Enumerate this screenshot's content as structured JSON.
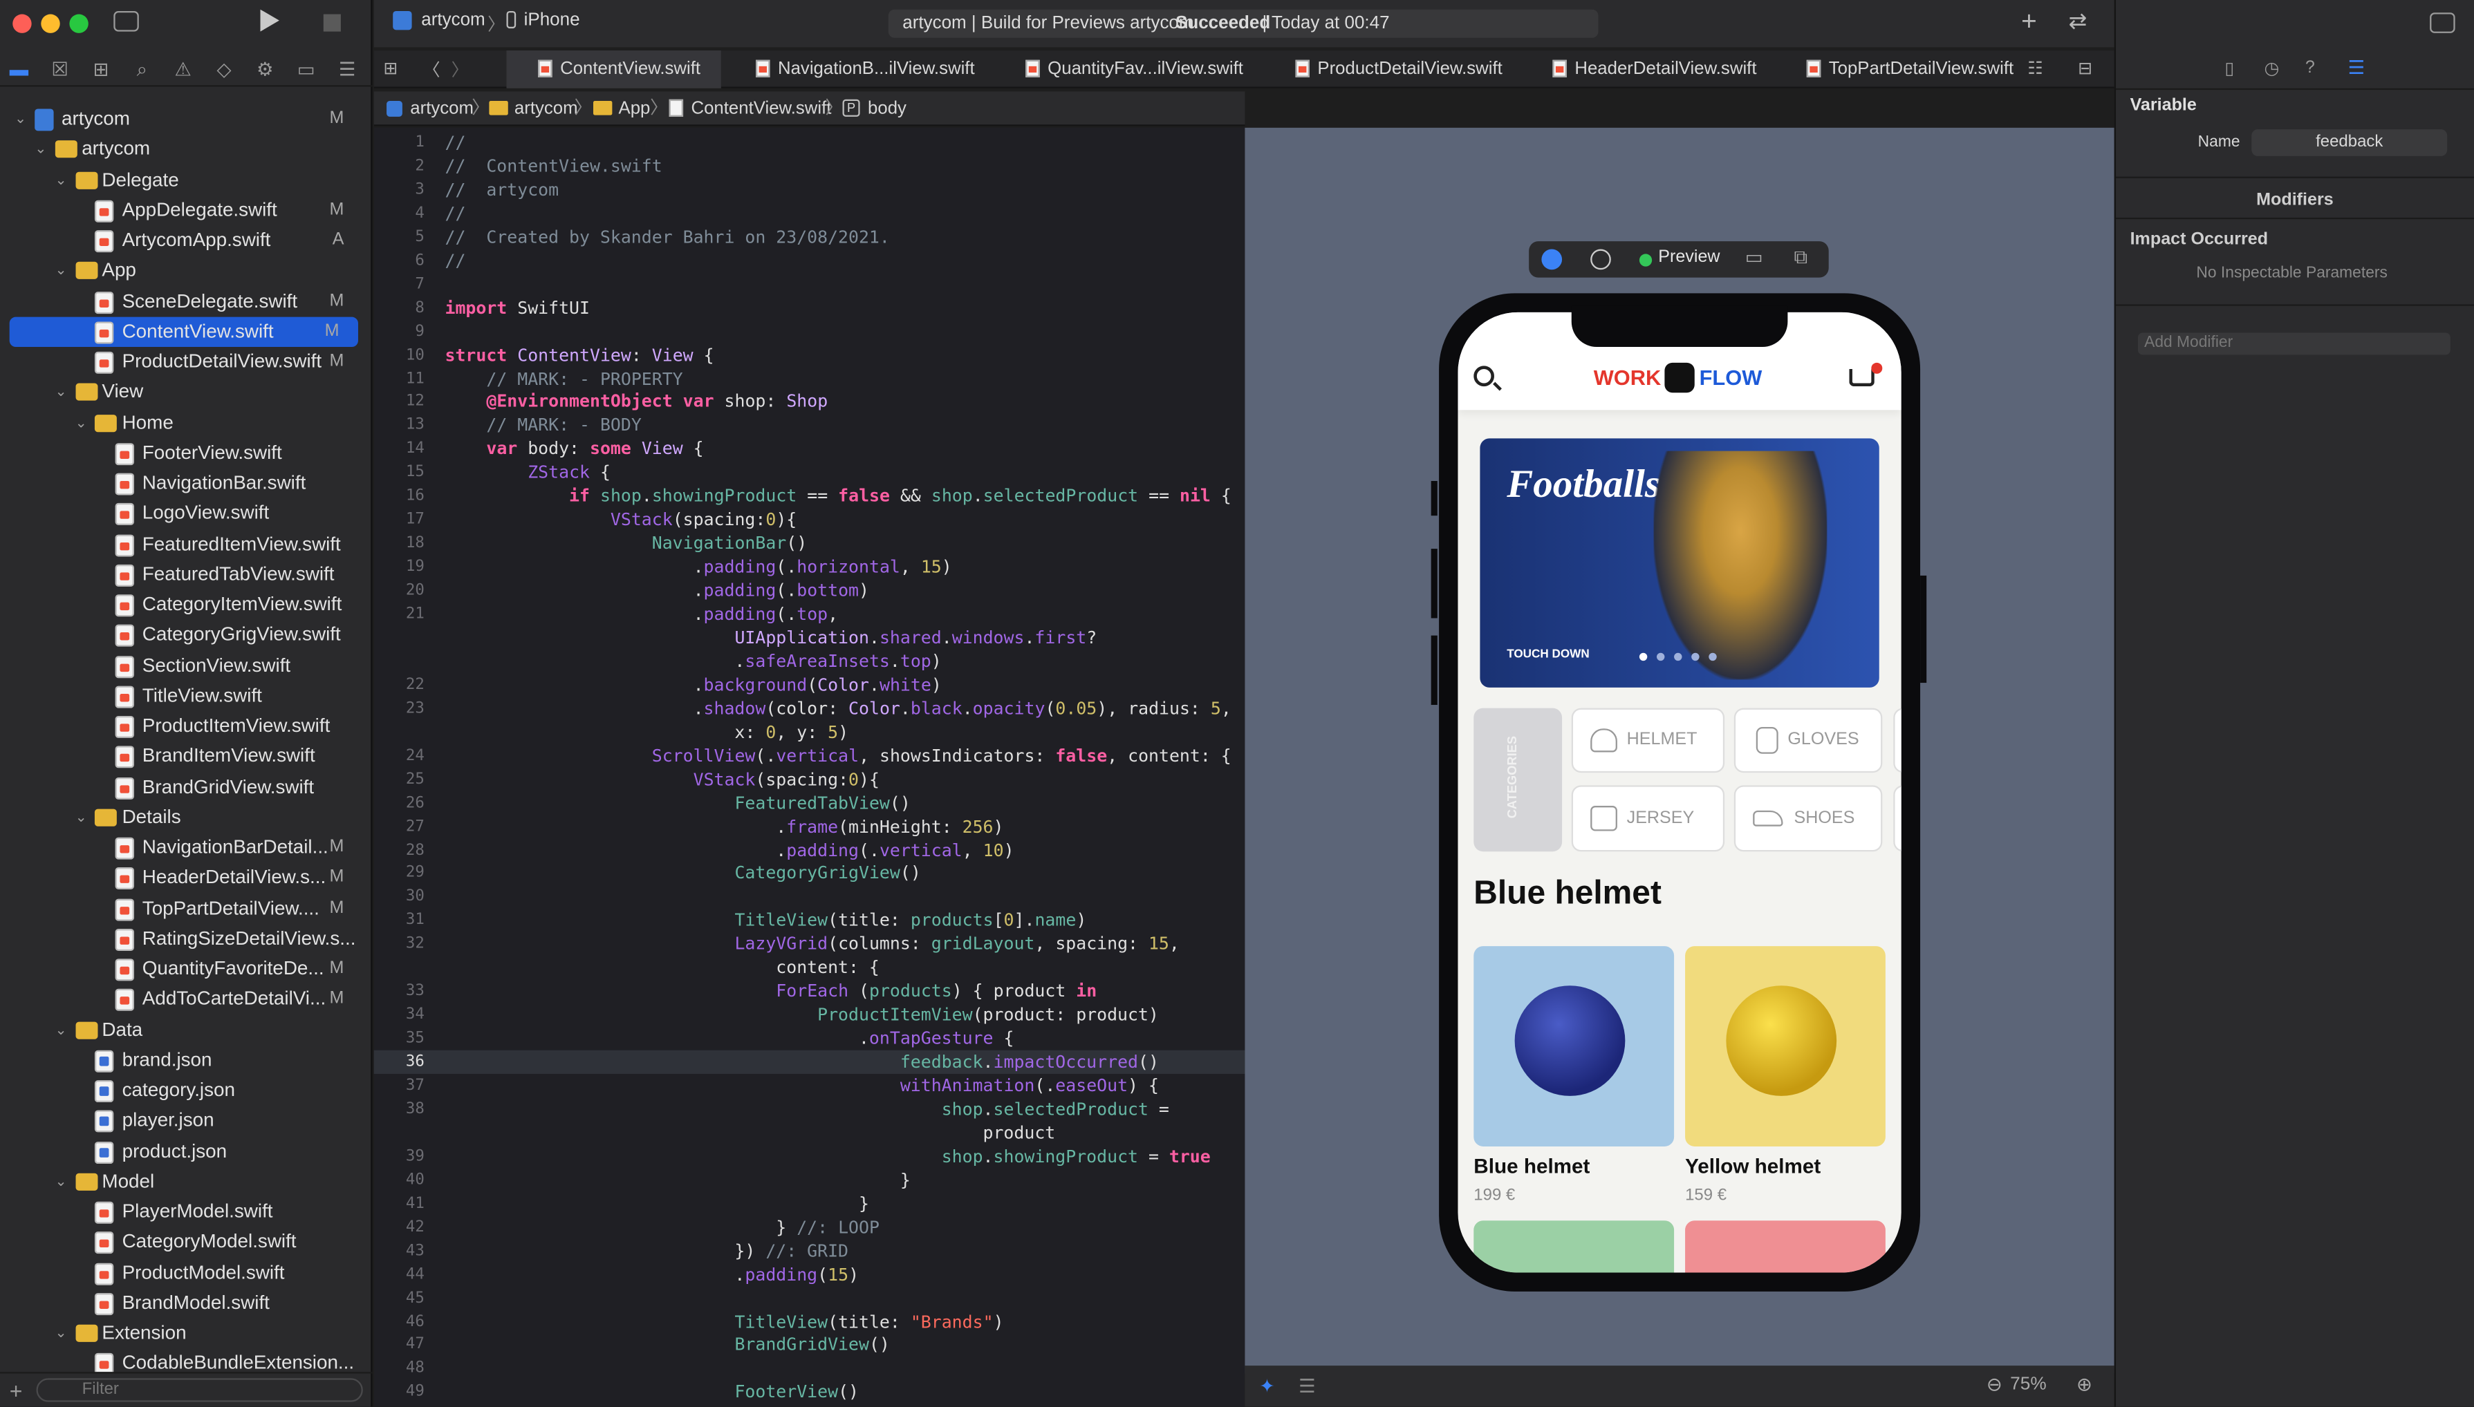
{
  "window": {
    "project": "artycom",
    "device": "iPhone",
    "activity_prefix": "artycom | Build for Previews artycom: ",
    "activity_status": "Succeeded",
    "activity_suffix": " | Today at 00:47"
  },
  "tabs": [
    "ContentView.swift",
    "NavigationB...ilView.swift",
    "QuantityFav...ilView.swift",
    "ProductDetailView.swift",
    "HeaderDetailView.swift",
    "TopPartDetailView.swift"
  ],
  "jumpbar": [
    "artycom",
    "artycom",
    "App",
    "ContentView.swift",
    "body"
  ],
  "navigator": {
    "filter_placeholder": "Filter",
    "items": [
      {
        "label": "artycom",
        "status": "M"
      },
      {
        "label": "artycom",
        "status": ""
      },
      {
        "label": "Delegate",
        "status": ""
      },
      {
        "label": "AppDelegate.swift",
        "status": "M"
      },
      {
        "label": "ArtycomApp.swift",
        "status": "A"
      },
      {
        "label": "App",
        "status": ""
      },
      {
        "label": "SceneDelegate.swift",
        "status": "M"
      },
      {
        "label": "ContentView.swift",
        "status": "M"
      },
      {
        "label": "ProductDetailView.swift",
        "status": "M"
      },
      {
        "label": "View",
        "status": ""
      },
      {
        "label": "Home",
        "status": ""
      },
      {
        "label": "FooterView.swift",
        "status": ""
      },
      {
        "label": "NavigationBar.swift",
        "status": ""
      },
      {
        "label": "LogoView.swift",
        "status": ""
      },
      {
        "label": "FeaturedItemView.swift",
        "status": ""
      },
      {
        "label": "FeaturedTabView.swift",
        "status": ""
      },
      {
        "label": "CategoryItemView.swift",
        "status": ""
      },
      {
        "label": "CategoryGrigView.swift",
        "status": ""
      },
      {
        "label": "SectionView.swift",
        "status": ""
      },
      {
        "label": "TitleView.swift",
        "status": ""
      },
      {
        "label": "ProductItemView.swift",
        "status": ""
      },
      {
        "label": "BrandItemView.swift",
        "status": ""
      },
      {
        "label": "BrandGridView.swift",
        "status": ""
      },
      {
        "label": "Details",
        "status": ""
      },
      {
        "label": "NavigationBarDetail...",
        "status": "M"
      },
      {
        "label": "HeaderDetailView.s...",
        "status": "M"
      },
      {
        "label": "TopPartDetailView....",
        "status": "M"
      },
      {
        "label": "RatingSizeDetailView.s...",
        "status": ""
      },
      {
        "label": "QuantityFavoriteDe...",
        "status": "M"
      },
      {
        "label": "AddToCarteDetailVi...",
        "status": "M"
      },
      {
        "label": "Data",
        "status": ""
      },
      {
        "label": "brand.json",
        "status": ""
      },
      {
        "label": "category.json",
        "status": ""
      },
      {
        "label": "player.json",
        "status": ""
      },
      {
        "label": "product.json",
        "status": ""
      },
      {
        "label": "Model",
        "status": ""
      },
      {
        "label": "PlayerModel.swift",
        "status": ""
      },
      {
        "label": "CategoryModel.swift",
        "status": ""
      },
      {
        "label": "ProductModel.swift",
        "status": ""
      },
      {
        "label": "BrandModel.swift",
        "status": ""
      },
      {
        "label": "Extension",
        "status": ""
      },
      {
        "label": "CodableBundleExtension...",
        "status": ""
      }
    ]
  },
  "code_line_numbers": [
    "1",
    "2",
    "3",
    "4",
    "5",
    "6",
    "7",
    "8",
    "9",
    "10",
    "11",
    "12",
    "13",
    "14",
    "15",
    "16",
    "17",
    "18",
    "19",
    "20",
    "21",
    "",
    "",
    "22",
    "23",
    "",
    "24",
    "25",
    "26",
    "27",
    "28",
    "29",
    "30",
    "31",
    "32",
    "",
    "33",
    "34",
    "35",
    "36",
    "37",
    "38",
    "",
    "39",
    "40",
    "41",
    "42",
    "43",
    "44",
    "45",
    "46",
    "47",
    "48",
    "49"
  ],
  "preview": {
    "label": "Preview",
    "logo_left": "WORK",
    "logo_right": "FLOW",
    "hero_title": "Footballs",
    "hero_brand": "TOUCH DOWN",
    "categories_label": "CATEGORIES",
    "categories": [
      "HELMET",
      "GLOVES",
      "JERSEY",
      "SHOES"
    ],
    "section_title": "Blue helmet",
    "products": [
      {
        "name": "Blue helmet",
        "price": "199 €"
      },
      {
        "name": "Yellow helmet",
        "price": "159 €"
      }
    ]
  },
  "zoom": "75%",
  "inspector": {
    "section": "Variable",
    "name_label": "Name",
    "name_value": "feedback",
    "modifiers": "Modifiers",
    "impact": "Impact Occurred",
    "no_params": "No Inspectable Parameters",
    "add_modifier": "Add Modifier"
  },
  "colors": {
    "accent": "#1f5bd6",
    "logo_red": "#e4362c",
    "logo_blue": "#1d5ad8",
    "hero_bg": "#1f3d8a"
  }
}
